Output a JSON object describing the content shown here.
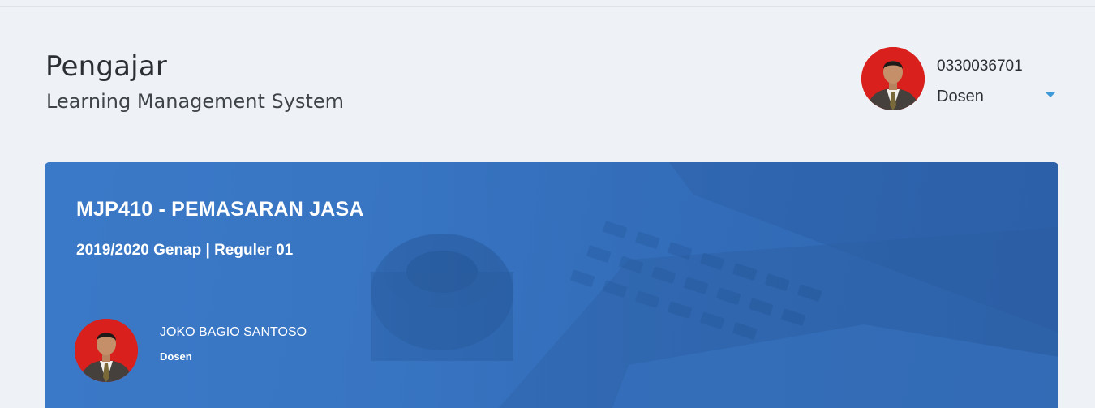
{
  "header": {
    "title": "Pengajar",
    "subtitle": "Learning Management System"
  },
  "user": {
    "id": "0330036701",
    "role": "Dosen",
    "avatar_icon": "user-photo-icon",
    "dropdown_icon": "caret-down-icon"
  },
  "course": {
    "title": "MJP410 - PEMASARAN JASA",
    "meta": "2019/2020 Genap | Reguler 01",
    "teacher": {
      "name": "JOKO BAGIO SANTOSO",
      "role": "Dosen"
    }
  },
  "colors": {
    "page_background": "#eef1f5",
    "card_blue": "#3572be",
    "accent": "#3f9ad8",
    "avatar_red": "#d9201c"
  }
}
